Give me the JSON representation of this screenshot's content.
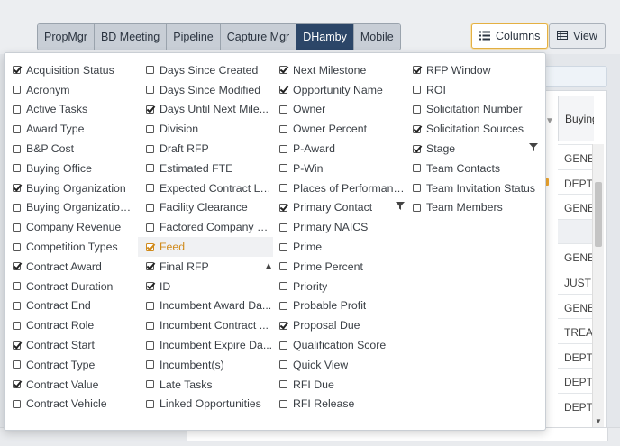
{
  "tabs": [
    {
      "label": "PropMgr",
      "active": false
    },
    {
      "label": "BD Meeting",
      "active": false
    },
    {
      "label": "Pipeline",
      "active": false
    },
    {
      "label": "Capture Mgr",
      "active": false
    },
    {
      "label": "DHamby",
      "active": true
    },
    {
      "label": "Mobile",
      "active": false
    }
  ],
  "toolbar": {
    "columns_label": "Columns",
    "view_label": "View"
  },
  "background_table": {
    "header": "Buying Organ",
    "cells": [
      "GENE",
      "DEPT",
      "GENE",
      "",
      "GENE",
      "JUSTI",
      "GENE",
      "TREAS",
      "DEPT",
      "DEPT",
      "DEPT"
    ]
  },
  "columns_menu": {
    "col1": [
      {
        "label": "Acquisition Status",
        "checked": true
      },
      {
        "label": "Acronym",
        "checked": false
      },
      {
        "label": "Active Tasks",
        "checked": false
      },
      {
        "label": "Award Type",
        "checked": false
      },
      {
        "label": "B&P Cost",
        "checked": false
      },
      {
        "label": "Buying Office",
        "checked": false
      },
      {
        "label": "Buying Organization",
        "checked": true
      },
      {
        "label": "Buying Organization ...",
        "checked": false
      },
      {
        "label": "Company Revenue",
        "checked": false
      },
      {
        "label": "Competition Types",
        "checked": false
      },
      {
        "label": "Contract Award",
        "checked": true
      },
      {
        "label": "Contract Duration",
        "checked": false
      },
      {
        "label": "Contract End",
        "checked": false
      },
      {
        "label": "Contract Role",
        "checked": false
      },
      {
        "label": "Contract Start",
        "checked": true
      },
      {
        "label": "Contract Type",
        "checked": false
      },
      {
        "label": "Contract Value",
        "checked": true
      },
      {
        "label": "Contract Vehicle",
        "checked": false
      }
    ],
    "col2": [
      {
        "label": "Days Since Created",
        "checked": false
      },
      {
        "label": "Days Since Modified",
        "checked": false
      },
      {
        "label": "Days Until Next Mile...",
        "checked": true
      },
      {
        "label": "Division",
        "checked": false
      },
      {
        "label": "Draft RFP",
        "checked": false
      },
      {
        "label": "Estimated FTE",
        "checked": false
      },
      {
        "label": "Expected Contract Le...",
        "checked": false
      },
      {
        "label": "Facility Clearance",
        "checked": false
      },
      {
        "label": "Factored Company R...",
        "checked": false
      },
      {
        "label": "Feed",
        "checked": true,
        "highlight": true
      },
      {
        "label": "Final RFP",
        "checked": true,
        "mark": "▲"
      },
      {
        "label": "ID",
        "checked": true
      },
      {
        "label": "Incumbent Award Da...",
        "checked": false
      },
      {
        "label": "Incumbent Contract ...",
        "checked": false
      },
      {
        "label": "Incumbent Expire Da...",
        "checked": false
      },
      {
        "label": "Incumbent(s)",
        "checked": false
      },
      {
        "label": "Late Tasks",
        "checked": false
      },
      {
        "label": "Linked Opportunities",
        "checked": false
      }
    ],
    "col3": [
      {
        "label": "Next Milestone",
        "checked": true
      },
      {
        "label": "Opportunity Name",
        "checked": true
      },
      {
        "label": "Owner",
        "checked": false
      },
      {
        "label": "Owner Percent",
        "checked": false
      },
      {
        "label": "P-Award",
        "checked": false
      },
      {
        "label": "P-Win",
        "checked": false
      },
      {
        "label": "Places of Performance",
        "checked": false
      },
      {
        "label": "Primary Contact",
        "checked": true,
        "mark": "filter"
      },
      {
        "label": "Primary NAICS",
        "checked": false
      },
      {
        "label": "Prime",
        "checked": false
      },
      {
        "label": "Prime Percent",
        "checked": false
      },
      {
        "label": "Priority",
        "checked": false
      },
      {
        "label": "Probable Profit",
        "checked": false
      },
      {
        "label": "Proposal Due",
        "checked": true
      },
      {
        "label": "Qualification Score",
        "checked": false
      },
      {
        "label": "Quick View",
        "checked": false
      },
      {
        "label": "RFI Due",
        "checked": false
      },
      {
        "label": "RFI Release",
        "checked": false
      }
    ],
    "col4": [
      {
        "label": "RFP Window",
        "checked": true
      },
      {
        "label": "ROI",
        "checked": false
      },
      {
        "label": "Solicitation Number",
        "checked": false
      },
      {
        "label": "Solicitation Sources",
        "checked": true
      },
      {
        "label": "Stage",
        "checked": true,
        "mark": "filter"
      },
      {
        "label": "Team Contacts",
        "checked": false
      },
      {
        "label": "Team Invitation Status",
        "checked": false
      },
      {
        "label": "Team Members",
        "checked": false
      }
    ]
  },
  "icons": {
    "columns": "list-icon",
    "view": "table-icon",
    "filter": "filter-icon",
    "sort": "sort-up-icon"
  }
}
